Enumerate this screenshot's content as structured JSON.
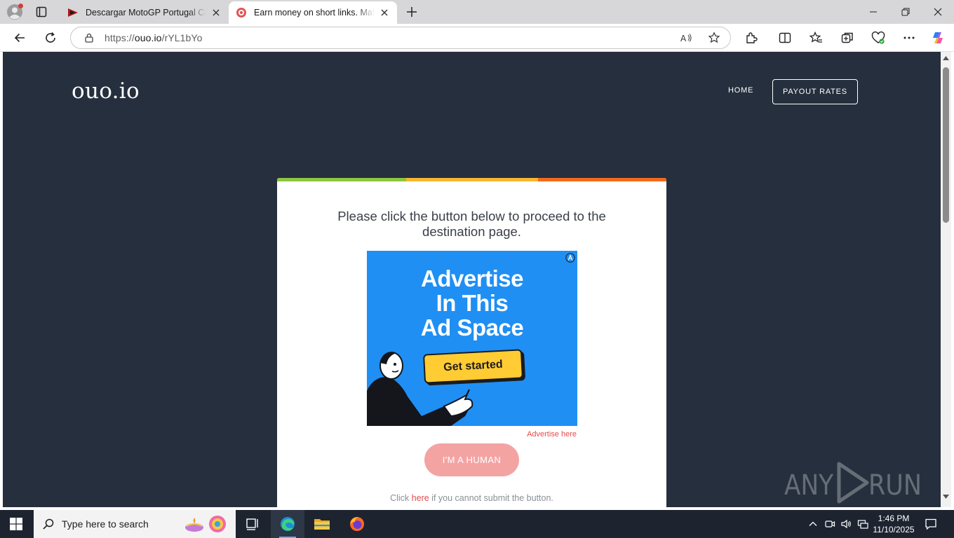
{
  "browser": {
    "tabs": [
      {
        "title": "Descargar MotoGP Portugal Carrera",
        "active": false
      },
      {
        "title": "Earn money on short links. Make sh",
        "active": true
      }
    ],
    "address": {
      "scheme": "https://",
      "host": "ouo.io",
      "path": "/rYL1bYo"
    }
  },
  "site": {
    "logo": "ouo.io",
    "nav": {
      "home": "HOME",
      "payout": "PAYOUT RATES"
    }
  },
  "card": {
    "message": "Please click the button below to proceed to the destination page.",
    "ad": {
      "line1": "Advertise",
      "line2": "In This",
      "line3": "Ad Space",
      "button": "Get started"
    },
    "advertise_link": "Advertise here",
    "human_button": "I'M A HUMAN",
    "help_prefix": "Click",
    "help_link": "here",
    "help_suffix": "if you cannot submit the button."
  },
  "watermark": "ANY RUN",
  "taskbar": {
    "search_placeholder": "Type here to search",
    "time": "1:46 PM",
    "date": "11/10/2025"
  },
  "colors": {
    "page_bg": "#262f3d",
    "stripe_green": "#8dc63f",
    "stripe_yellow": "#f7b731",
    "stripe_orange": "#f26b1d",
    "ad_blue": "#1f8ff4",
    "accent_red": "#e44c4c",
    "human_button": "#f4a3a3"
  }
}
